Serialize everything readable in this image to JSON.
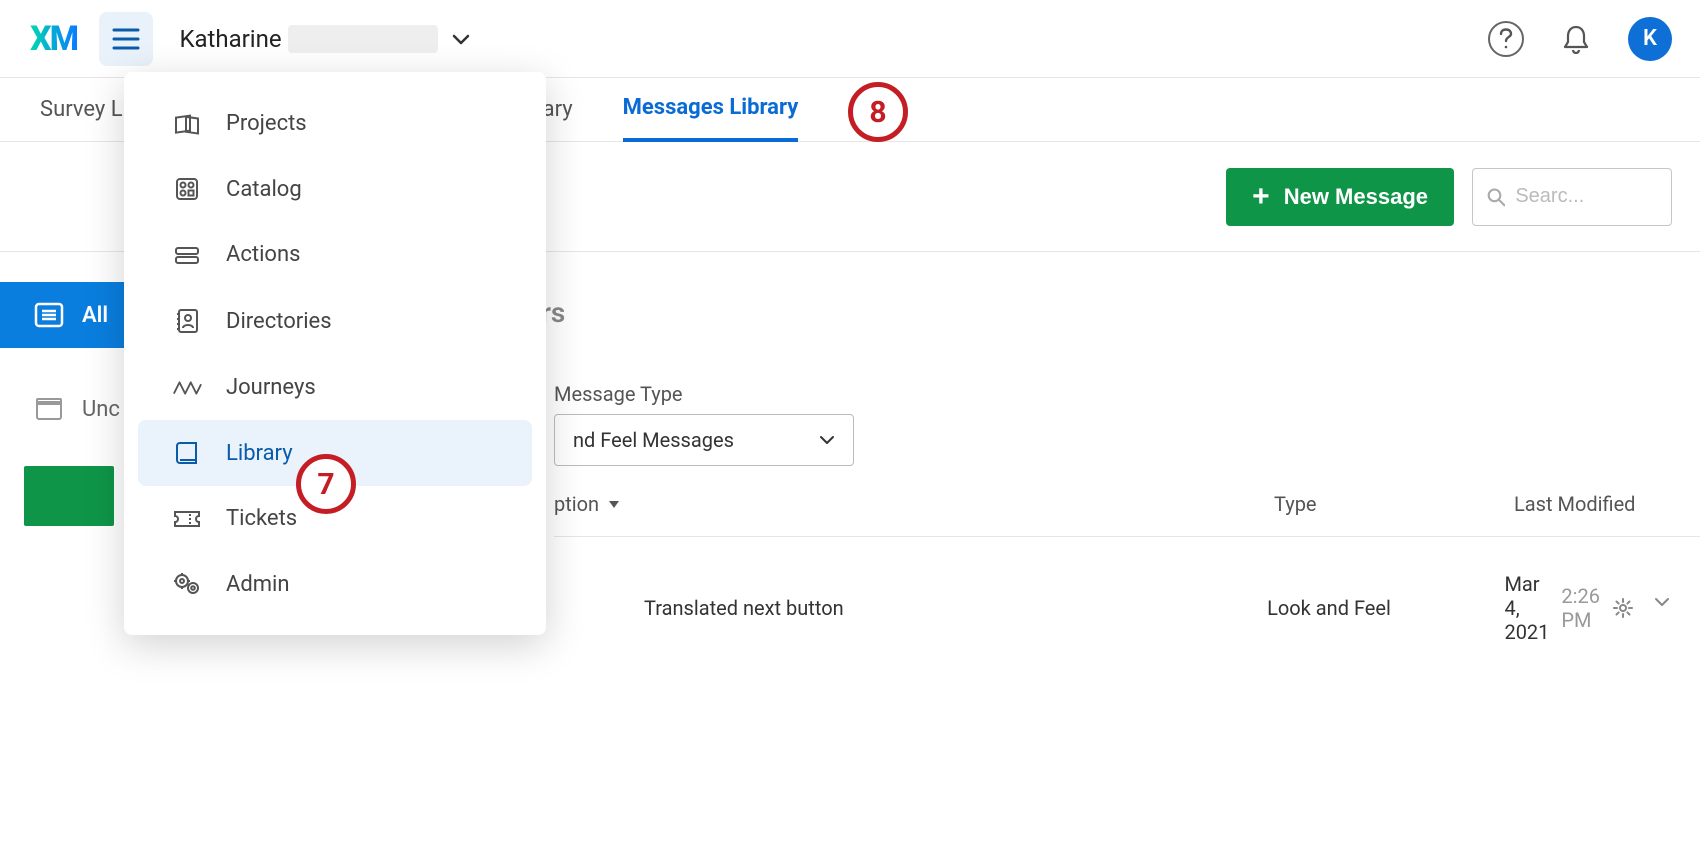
{
  "topbar": {
    "logo_text": "XM",
    "username_visible": "Katharine",
    "avatar_letter": "K"
  },
  "tabs": {
    "survey_partial": "Survey L",
    "ary_partial": "ary",
    "messages": "Messages Library"
  },
  "actionbar": {
    "new_message": "New Message",
    "search_placeholder": "Searc..."
  },
  "sidebar": {
    "all_label": "All",
    "unc_label": "Unc"
  },
  "main": {
    "heading_partial": "ders",
    "filter_label": "Message Type",
    "filter_value_partial": "nd Feel Messages",
    "columns": {
      "desc": "ption",
      "type": "Type",
      "modified": "Last Modified"
    },
    "row": {
      "desc": "Translated next button",
      "type": "Look and Feel",
      "date": "Mar 4, 2021",
      "time": "2:26 PM"
    }
  },
  "dropdown": {
    "items": [
      {
        "label": "Projects"
      },
      {
        "label": "Catalog"
      },
      {
        "label": "Actions"
      },
      {
        "label": "Directories"
      },
      {
        "label": "Journeys"
      },
      {
        "label": "Library"
      },
      {
        "label": "Tickets"
      },
      {
        "label": "Admin"
      }
    ]
  },
  "annotations": {
    "seven": "7",
    "eight": "8"
  }
}
